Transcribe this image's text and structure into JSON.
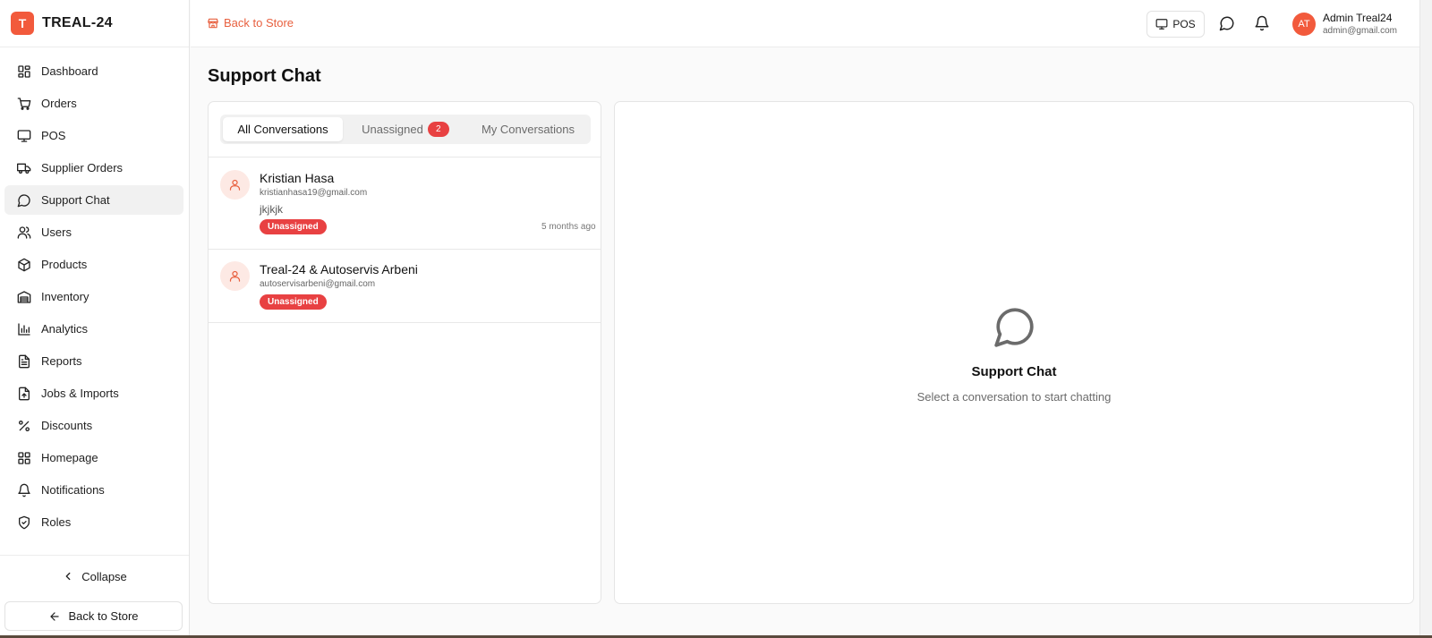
{
  "brand": {
    "logo_letter": "T",
    "name": "TREAL-24"
  },
  "sidebar": {
    "items": [
      {
        "label": "Dashboard",
        "icon": "dashboard-icon"
      },
      {
        "label": "Orders",
        "icon": "cart-icon"
      },
      {
        "label": "POS",
        "icon": "monitor-icon"
      },
      {
        "label": "Supplier Orders",
        "icon": "truck-icon"
      },
      {
        "label": "Support Chat",
        "icon": "chat-icon",
        "active": true
      },
      {
        "label": "Users",
        "icon": "users-icon"
      },
      {
        "label": "Products",
        "icon": "package-icon"
      },
      {
        "label": "Inventory",
        "icon": "warehouse-icon"
      },
      {
        "label": "Analytics",
        "icon": "bar-chart-icon"
      },
      {
        "label": "Reports",
        "icon": "file-text-icon"
      },
      {
        "label": "Jobs & Imports",
        "icon": "file-upload-icon"
      },
      {
        "label": "Discounts",
        "icon": "percent-icon"
      },
      {
        "label": "Homepage",
        "icon": "layout-grid-icon"
      },
      {
        "label": "Notifications",
        "icon": "bell-icon"
      },
      {
        "label": "Roles",
        "icon": "shield-icon"
      }
    ],
    "collapse_label": "Collapse",
    "back_label": "Back to Store"
  },
  "topbar": {
    "back_label": "Back to Store",
    "pos_label": "POS",
    "avatar_initials": "AT",
    "user_name": "Admin Treal24",
    "user_email": "admin@gmail.com"
  },
  "page": {
    "title": "Support Chat"
  },
  "tabs": {
    "all": "All Conversations",
    "unassigned": "Unassigned",
    "unassigned_count": "2",
    "mine": "My Conversations"
  },
  "conversations": [
    {
      "name": "Kristian Hasa",
      "email": "kristianhasa19@gmail.com",
      "message": "jkjkjk",
      "status": "Unassigned",
      "time": "5 months ago"
    },
    {
      "name": "Treal-24 & Autoservis Arbeni",
      "email": "autoservisarbeni@gmail.com",
      "status": "Unassigned"
    }
  ],
  "empty_state": {
    "title": "Support Chat",
    "subtitle": "Select a conversation to start chatting"
  },
  "colors": {
    "accent": "#f25a3c",
    "badge": "#e84142",
    "link": "#e8603f"
  }
}
